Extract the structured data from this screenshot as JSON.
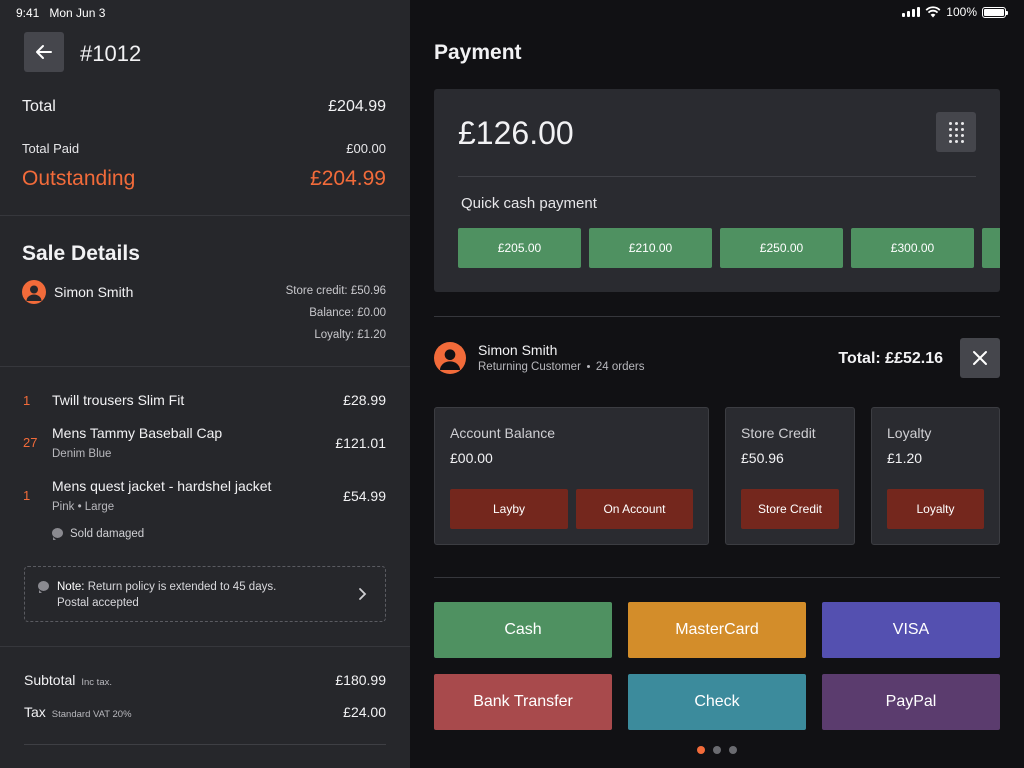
{
  "status_bar": {
    "time": "9:41",
    "date": "Mon Jun 3",
    "battery": "100%"
  },
  "order": {
    "number": "#1012"
  },
  "totals": {
    "total_label": "Total",
    "total_value": "£204.99",
    "paid_label": "Total Paid",
    "paid_value": "£00.00",
    "outstanding_label": "Outstanding",
    "outstanding_value": "£204.99"
  },
  "sale_details": {
    "title": "Sale Details",
    "customer_name": "Simon Smith",
    "store_credit": "Store credit: £50.96",
    "balance": "Balance: £0.00",
    "loyalty": "Loyalty: £1.20"
  },
  "items": [
    {
      "qty": "1",
      "name": "Twill trousers Slim Fit",
      "price": "£28.99"
    },
    {
      "qty": "27",
      "name": "Mens Tammy Baseball Cap",
      "variant": "Denim Blue",
      "price": "£121.01"
    },
    {
      "qty": "1",
      "name": "Mens quest jacket - hardshel jacket",
      "variant": "Pink • Large",
      "comment": "Sold damaged",
      "price": "£54.99"
    }
  ],
  "note": {
    "label": "Note:",
    "line1": "Return policy is extended to 45 days.",
    "line2": "Postal accepted"
  },
  "summary": {
    "subtotal_label": "Subtotal",
    "subtotal_note": "Inc tax.",
    "subtotal_value": "£180.99",
    "tax_label": "Tax",
    "tax_note": "Standard VAT 20%",
    "tax_value": "£24.00"
  },
  "payment": {
    "title": "Payment",
    "amount": "£126.00",
    "quick_label": "Quick cash payment",
    "quick_amounts": [
      "£205.00",
      "£210.00",
      "£250.00",
      "£300.00",
      ""
    ]
  },
  "customer": {
    "name": "Simon Smith",
    "type": "Returning Customer",
    "orders": "24 orders",
    "total": "Total: ££52.16"
  },
  "accounts": {
    "balance_title": "Account Balance",
    "balance_value": "£00.00",
    "layby_button": "Layby",
    "on_account_button": "On Account",
    "credit_title": "Store Credit",
    "credit_value": "£50.96",
    "credit_button": "Store Credit",
    "loyalty_title": "Loyalty",
    "loyalty_value": "£1.20",
    "loyalty_button": "Loyalty"
  },
  "methods": [
    {
      "label": "Cash",
      "color": "#4f9161"
    },
    {
      "label": "MasterCard",
      "color": "#d38d2a"
    },
    {
      "label": "VISA",
      "color": "#5450b0"
    },
    {
      "label": "Bank Transfer",
      "color": "#a84a4c"
    },
    {
      "label": "Check",
      "color": "#3c8b9c"
    },
    {
      "label": "PayPal",
      "color": "#5b3c6e"
    }
  ],
  "colors": {
    "accent": "#f26b3a",
    "quick_cash": "#4f9161",
    "account_button": "#74271d"
  }
}
